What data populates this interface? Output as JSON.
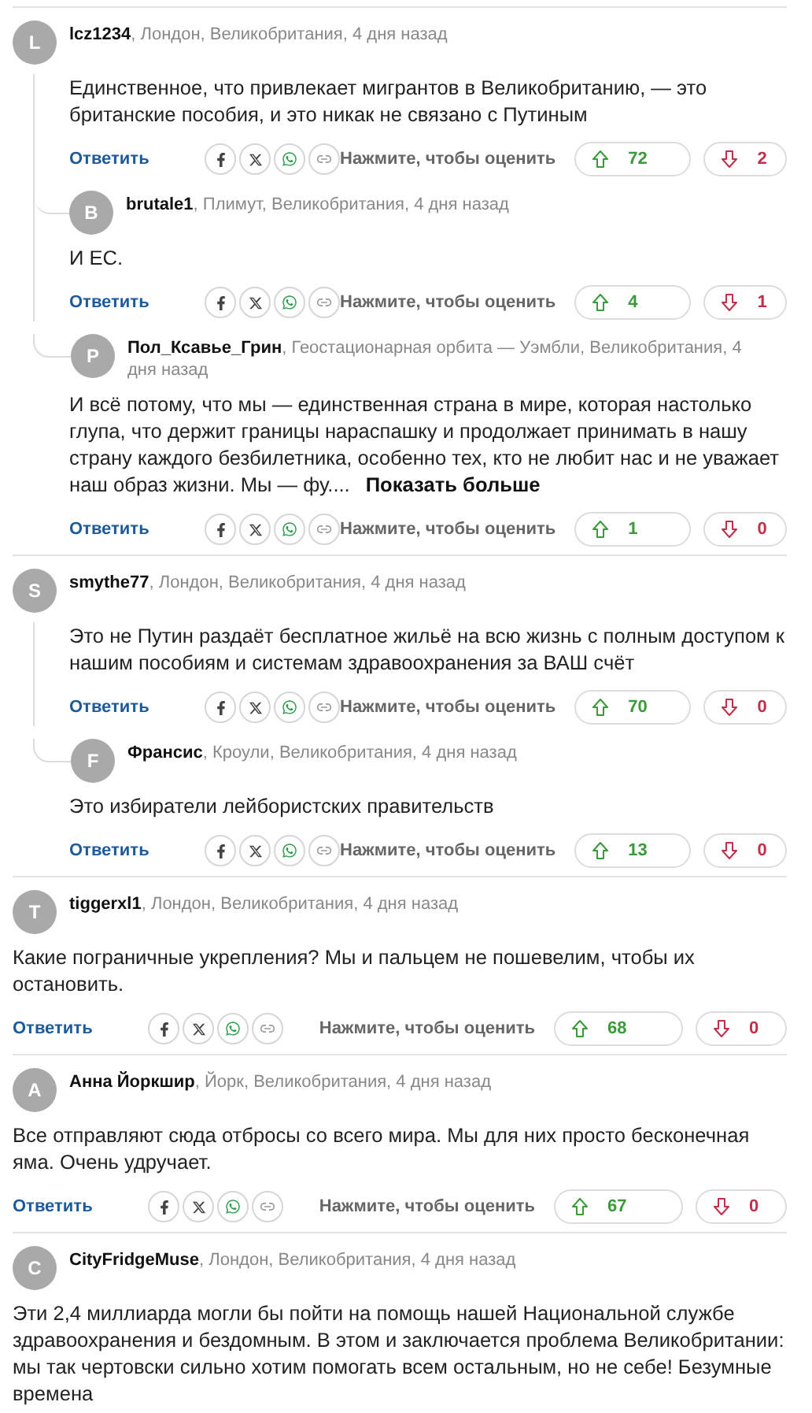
{
  "threads": [
    {
      "avatar": "L",
      "author": "lcz1234",
      "meta": ", Лондон, Великобритания, 4 дня назад",
      "text": "Единственное, что привлекает мигрантов в Великобританию, — это британские пособия, и это никак не связано с Путиным",
      "reply": "Ответить",
      "rate_label": "Нажмите, чтобы оценить",
      "up": "72",
      "down": "2",
      "replies": [
        {
          "avatar": "B",
          "author": "brutale1",
          "meta": ", Плимут, Великобритания, 4 дня назад",
          "text": "И ЕС.",
          "reply": "Ответить",
          "rate_label": "Нажмите, чтобы оценить",
          "up": "4",
          "down": "1"
        },
        {
          "avatar": "P",
          "author": "Пол_Ксавье_Грин",
          "meta": ", Геостационарная орбита — Уэмбли, Великобритания, 4 дня назад",
          "text": "И всё потому, что мы — единственная страна в мире, которая настолько глупа, что держит границы нараспашку и продолжает принимать в нашу страну каждого безбилетника, особенно тех, кто не любит нас и не уважает наш образ жизни. Мы — фу....",
          "more": "Показать больше",
          "reply": "Ответить",
          "rate_label": "Нажмите, чтобы оценить",
          "up": "1",
          "down": "0"
        }
      ]
    },
    {
      "avatar": "S",
      "author": "smythe77",
      "meta": ", Лондон, Великобритания, 4 дня назад",
      "text": "Это не Путин раздаёт бесплатное жильё на всю жизнь с полным доступом к нашим пособиям и системам здравоохранения за ВАШ счёт",
      "reply": "Ответить",
      "rate_label": "Нажмите, чтобы оценить",
      "up": "70",
      "down": "0",
      "replies": [
        {
          "avatar": "F",
          "author": "Франсис",
          "meta": ", Кроули, Великобритания, 4 дня назад",
          "text": "Это избиратели лейбористских правительств",
          "reply": "Ответить",
          "rate_label": "Нажмите, чтобы оценить",
          "up": "13",
          "down": "0"
        }
      ]
    },
    {
      "avatar": "T",
      "author": "tiggerxl1",
      "meta": ", Лондон, Великобритания, 4 дня назад",
      "text": "Какие пограничные укрепления? Мы и пальцем не пошевелим, чтобы их остановить.",
      "reply": "Ответить",
      "rate_label": "Нажмите, чтобы оценить",
      "up": "68",
      "down": "0"
    },
    {
      "avatar": "A",
      "author": "Анна Йоркшир",
      "meta": ", Йорк, Великобритания, 4 дня назад",
      "text": "Все отправляют сюда отбросы со всего мира. Мы для них просто бесконечная яма. Очень удручает.",
      "reply": "Ответить",
      "rate_label": "Нажмите, чтобы оценить",
      "up": "67",
      "down": "0"
    },
    {
      "avatar": "C",
      "author": "CityFridgeMuse",
      "meta": ", Лондон, Великобритания, 4 дня назад",
      "text": "Эти 2,4 миллиарда могли бы пойти на помощь нашей Национальной службе здравоохранения и бездомным. В этом и заключается проблема Великобритании: мы так чертовски сильно хотим помогать всем остальным, но не себе! Безумные времена"
    }
  ]
}
